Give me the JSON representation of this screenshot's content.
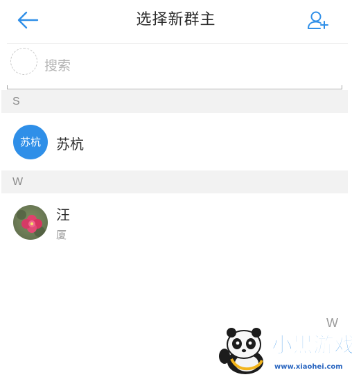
{
  "header": {
    "title": "选择新群主",
    "back_icon": "back-arrow-icon",
    "add_icon": "add-person-icon"
  },
  "search": {
    "placeholder": "搜索",
    "value": ""
  },
  "sections": [
    {
      "letter": "S",
      "contacts": [
        {
          "name": "苏杭",
          "avatar_text": "苏杭",
          "avatar_type": "text"
        }
      ]
    },
    {
      "letter": "W",
      "contacts": [
        {
          "name": "汪",
          "subtitle": "厦",
          "avatar_type": "photo"
        }
      ]
    }
  ],
  "index_letter": "W",
  "watermark": {
    "title": "小黑游戏",
    "url": "www.xiaohei.com"
  },
  "colors": {
    "accent": "#2f8fe8",
    "section_bg": "#f2f2f2"
  }
}
